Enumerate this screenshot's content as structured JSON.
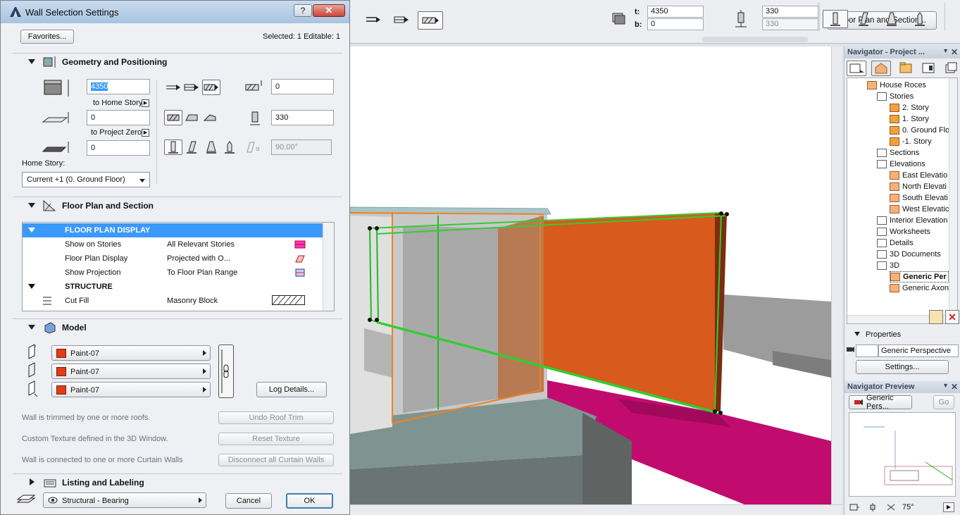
{
  "dialog": {
    "title": "Wall Selection Settings",
    "help_label": "?",
    "close_label": "✕",
    "favorites_label": "Favorites...",
    "selection_info": "Selected: 1 Editable: 1",
    "geometry": {
      "header": "Geometry and Positioning",
      "top_value": "4350",
      "to_home_story": "to Home Story",
      "bottom_value": "0",
      "to_project_zero": "to Project Zero",
      "offset_value": "0",
      "home_story_label": "Home Story:",
      "home_story_value": "Current +1 (0. Ground Floor)",
      "ref_offset_value": "0",
      "thickness_value": "330",
      "angle_value": "90.00°"
    },
    "floorplan": {
      "header": "Floor Plan and Section",
      "rows": [
        {
          "type": "header",
          "name": "FLOOR PLAN DISPLAY",
          "value": ""
        },
        {
          "type": "item",
          "name": "Show on Stories",
          "value": "All Relevant Stories"
        },
        {
          "type": "item",
          "name": "Floor Plan Display",
          "value": "Projected with O..."
        },
        {
          "type": "item",
          "name": "Show Projection",
          "value": "To Floor Plan Range"
        },
        {
          "type": "group",
          "name": "STRUCTURE",
          "value": ""
        },
        {
          "type": "item",
          "name": "Cut Fill",
          "value": "Masonry Block"
        }
      ]
    },
    "model": {
      "header": "Model",
      "paints": [
        "Paint-07",
        "Paint-07",
        "Paint-07"
      ],
      "paint_color": "#e23b18",
      "log_details_label": "Log Details...",
      "notes": [
        {
          "text": "Wall is trimmed by one or more roofs.",
          "button": "Undo Roof Trim"
        },
        {
          "text": "Custom Texture defined in the 3D Window.",
          "button": "Reset Texture"
        },
        {
          "text": "Wall is connected to one or more Curtain Walls",
          "button": "Disconnect all Curtain Walls"
        }
      ]
    },
    "listing": {
      "header": "Listing and Labeling"
    },
    "footer": {
      "layer_value": "Structural - Bearing",
      "cancel_label": "Cancel",
      "ok_label": "OK"
    }
  },
  "toolbar": {
    "floor_plan_button": "Floor Plan and Section...",
    "t_label": "t:",
    "t_value": "4350",
    "b_label": "b:",
    "b_value": "0",
    "thickness_value": "330",
    "thickness_value2": "330"
  },
  "navigator": {
    "title": "Navigator - Project ...",
    "tree": [
      {
        "label": "House Roces",
        "level": 0,
        "icon": "house"
      },
      {
        "label": "Stories",
        "level": 1,
        "icon": "stories"
      },
      {
        "label": "2. Story",
        "level": 2,
        "icon": "story"
      },
      {
        "label": "1. Story",
        "level": 2,
        "icon": "story"
      },
      {
        "label": "0. Ground Flo",
        "level": 2,
        "icon": "story"
      },
      {
        "label": "-1. Story",
        "level": 2,
        "icon": "story"
      },
      {
        "label": "Sections",
        "level": 1,
        "icon": "section"
      },
      {
        "label": "Elevations",
        "level": 1,
        "icon": "section"
      },
      {
        "label": "East Elevatio",
        "level": 2,
        "icon": "house"
      },
      {
        "label": "North Elevati",
        "level": 2,
        "icon": "house"
      },
      {
        "label": "South Elevati",
        "level": 2,
        "icon": "house"
      },
      {
        "label": "West Elevatic",
        "level": 2,
        "icon": "house"
      },
      {
        "label": "Interior Elevation",
        "level": 1,
        "icon": "section"
      },
      {
        "label": "Worksheets",
        "level": 1,
        "icon": "section"
      },
      {
        "label": "Details",
        "level": 1,
        "icon": "section"
      },
      {
        "label": "3D Documents",
        "level": 1,
        "icon": "section"
      },
      {
        "label": "3D",
        "level": 1,
        "icon": "section"
      },
      {
        "label": "Generic Per",
        "level": 2,
        "icon": "camera",
        "selected": true
      },
      {
        "label": "Generic Axon",
        "level": 2,
        "icon": "house"
      }
    ],
    "properties_label": "Properties",
    "properties_value": "Generic Perspective",
    "settings_label": "Settings...",
    "preview_title": "Navigator Preview",
    "preview_view": "Generic Pers...",
    "go_label": "Go",
    "angle_value": "75°"
  }
}
